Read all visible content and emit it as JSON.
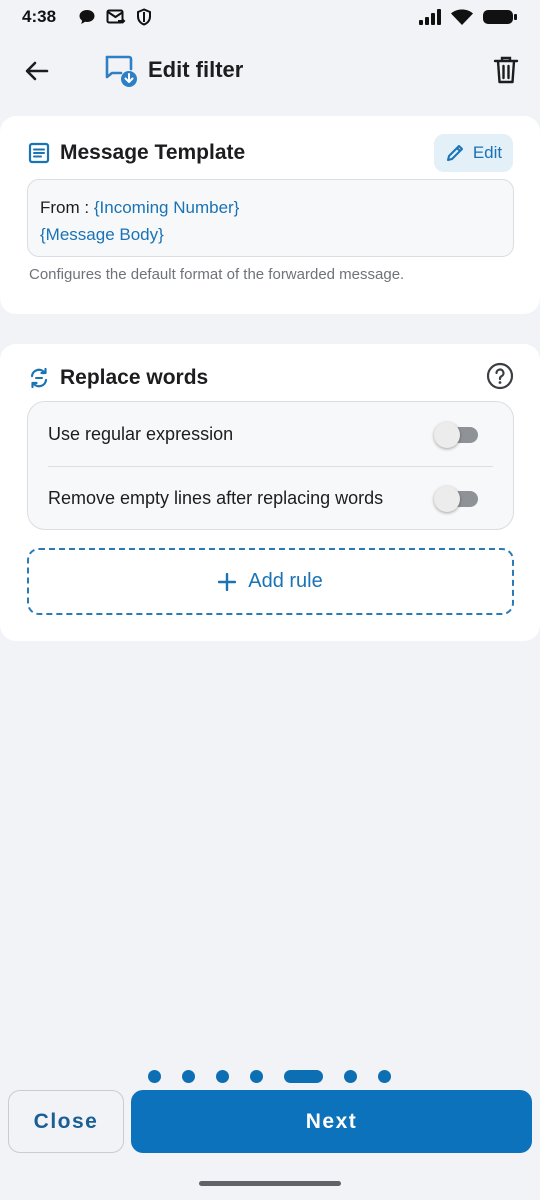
{
  "status_bar": {
    "time": "4:38",
    "left_icons": [
      "chat-bubble-icon",
      "message-forward-icon",
      "shield-icon"
    ],
    "right_icons": [
      "signal-icon",
      "wifi-icon",
      "battery-icon"
    ]
  },
  "header": {
    "back_icon": "arrow-left-icon",
    "title_icon": "message-download-icon",
    "title": "Edit filter",
    "delete_icon": "trash-icon"
  },
  "template_card": {
    "icon": "document-icon",
    "title": "Message Template",
    "edit_label": "Edit",
    "edit_icon": "pencil-icon",
    "template_prefix": "From : ",
    "template_token_1": "{Incoming Number}",
    "template_token_2": "{Message Body}",
    "helper_text": "Configures the default format of the forwarded message."
  },
  "replace_card": {
    "icon": "replace-icon",
    "title": "Replace words",
    "help_icon": "help-circle-icon",
    "toggles": [
      {
        "label": "Use regular expression",
        "checked": false
      },
      {
        "label": "Remove empty lines after replacing words",
        "checked": false
      }
    ],
    "add_rule_label": "Add rule",
    "add_rule_icon": "plus-icon"
  },
  "pager": {
    "total": 7,
    "active_index": 4
  },
  "footer": {
    "close_label": "Close",
    "next_label": "Next"
  },
  "colors": {
    "accent": "#0d72bc",
    "link": "#1a73b5",
    "background": "#f1f3f6",
    "card": "#ffffff"
  }
}
